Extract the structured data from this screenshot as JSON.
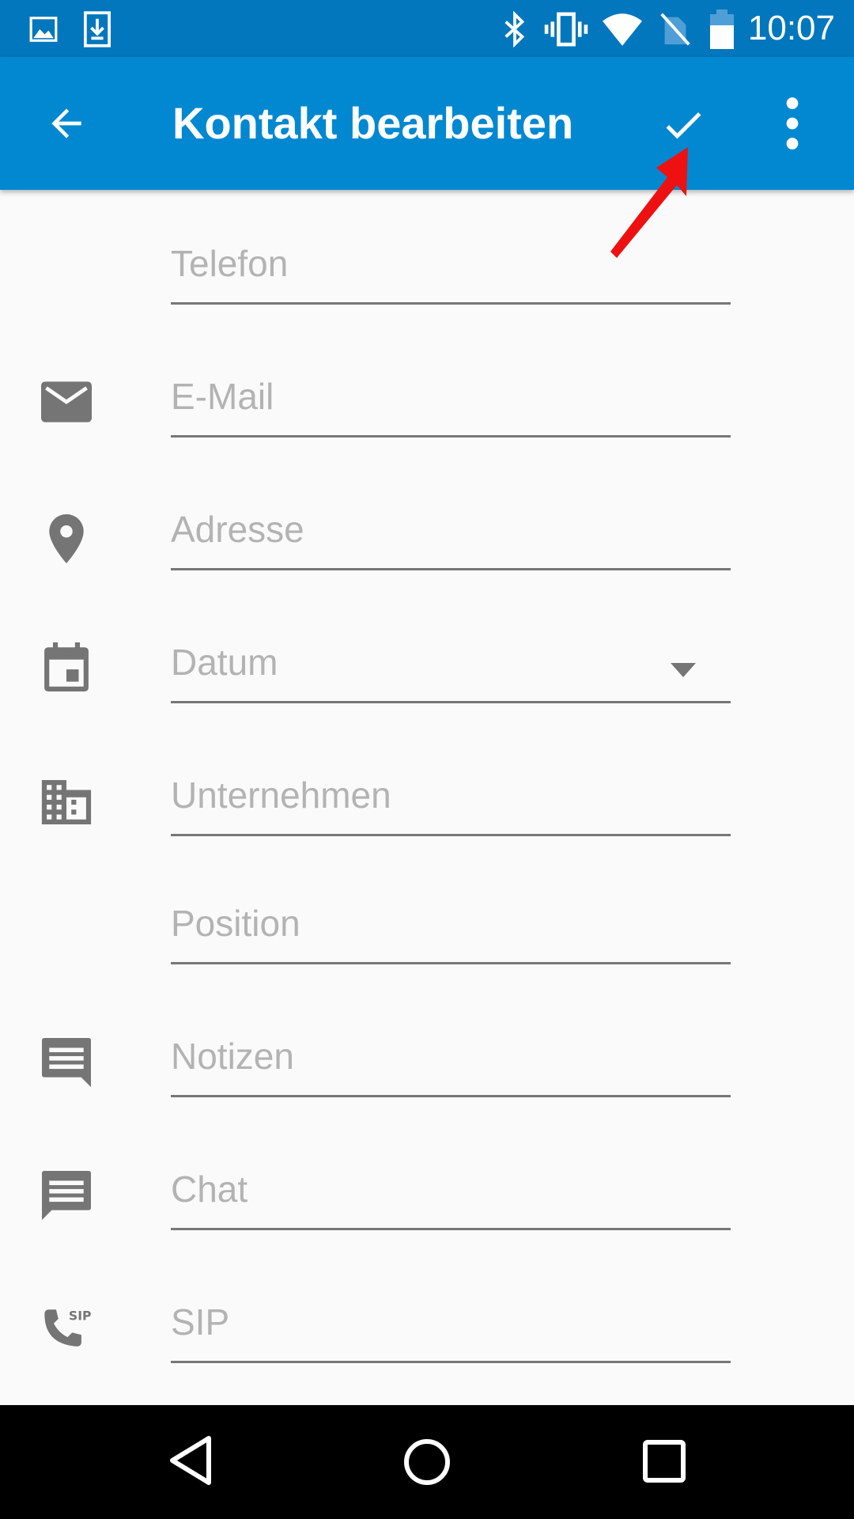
{
  "status_bar": {
    "time": "10:07",
    "icons": [
      "image-notification-icon",
      "download-notification-icon",
      "bluetooth-icon",
      "vibrate-icon",
      "wifi-icon",
      "no-sim-icon",
      "battery-icon"
    ]
  },
  "app_bar": {
    "title": "Kontakt bearbeiten",
    "actions": [
      "back-arrow-icon",
      "checkmark-icon",
      "more-options-icon"
    ]
  },
  "form": {
    "fields": [
      {
        "placeholder": "Telefon",
        "icon": ""
      },
      {
        "placeholder": "E-Mail",
        "icon": "email-icon"
      },
      {
        "placeholder": "Adresse",
        "icon": "location-pin-icon"
      },
      {
        "placeholder": "Datum",
        "icon": "calendar-icon"
      },
      {
        "placeholder": "Unternehmen",
        "icon": "company-building-icon"
      },
      {
        "placeholder": "Position",
        "icon": ""
      },
      {
        "placeholder": "Notizen",
        "icon": "notes-icon"
      },
      {
        "placeholder": "Chat",
        "icon": "chat-icon"
      },
      {
        "placeholder": "SIP",
        "icon": "sip-call-icon"
      }
    ]
  },
  "nav_bar": {
    "buttons": [
      "back-nav-icon",
      "home-nav-icon",
      "recents-nav-icon"
    ]
  },
  "colors": {
    "status_bar": "#0277bd",
    "app_bar": "#0288d1",
    "background": "#fafafa",
    "placeholder_text": "#b3b3b3",
    "icon_gray": "#757575",
    "annotation_arrow": "#ee1111"
  }
}
